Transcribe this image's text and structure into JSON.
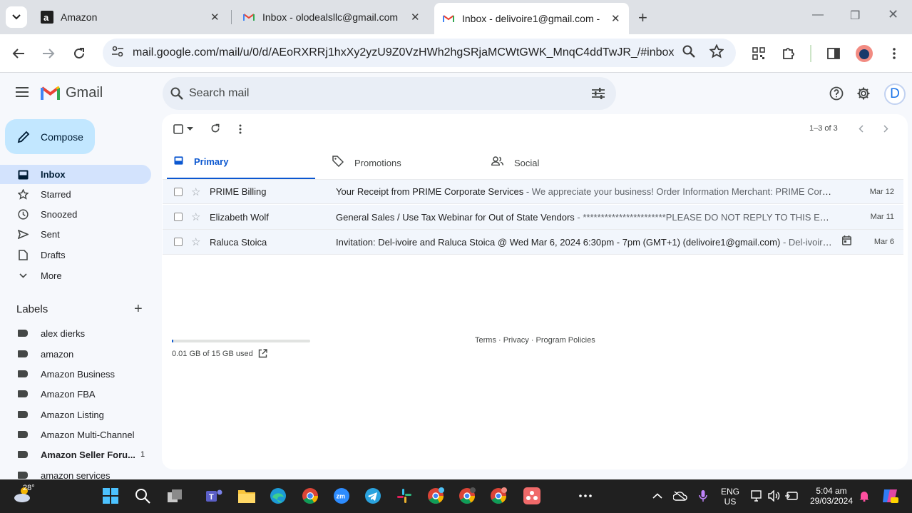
{
  "browser": {
    "tabs": [
      {
        "title": "Amazon",
        "favicon": "amazon-icon"
      },
      {
        "title": "Inbox - olodealsllc@gmail.com",
        "favicon": "gmail-icon"
      },
      {
        "title": "Inbox - delivoire1@gmail.com -",
        "favicon": "gmail-icon",
        "active": true
      }
    ],
    "url": "mail.google.com/mail/u/0/d/AEoRXRRj1hxXy2yzU9Z0VzHWh2hgSRjaMCWtGWK_MnqC4ddTwJR_/#inbox"
  },
  "gmail": {
    "app_name": "Gmail",
    "search_placeholder": "Search mail",
    "avatar_letter": "D",
    "compose_label": "Compose",
    "nav": [
      {
        "label": "Inbox",
        "icon": "inbox-icon",
        "active": true
      },
      {
        "label": "Starred",
        "icon": "star-icon"
      },
      {
        "label": "Snoozed",
        "icon": "clock-icon"
      },
      {
        "label": "Sent",
        "icon": "send-icon"
      },
      {
        "label": "Drafts",
        "icon": "draft-icon"
      },
      {
        "label": "More",
        "icon": "chevron-down-icon"
      }
    ],
    "labels_heading": "Labels",
    "labels": [
      {
        "name": "alex dierks",
        "count": ""
      },
      {
        "name": "amazon",
        "count": ""
      },
      {
        "name": "Amazon Business",
        "count": ""
      },
      {
        "name": "Amazon FBA",
        "count": ""
      },
      {
        "name": "Amazon Listing",
        "count": ""
      },
      {
        "name": "Amazon Multi-Channel",
        "count": ""
      },
      {
        "name": "Amazon Seller Foru...",
        "count": "1",
        "bold": true
      },
      {
        "name": "amazon services",
        "count": ""
      }
    ],
    "pager": "1–3 of 3",
    "categories": [
      {
        "label": "Primary",
        "icon": "inbox-icon",
        "active": true
      },
      {
        "label": "Promotions",
        "icon": "tag-icon"
      },
      {
        "label": "Social",
        "icon": "people-icon"
      }
    ],
    "emails": [
      {
        "sender": "PRIME Billing",
        "subject": "Your Receipt from PRIME Corporate Services",
        "preview": " - We appreciate your business! Order Information Merchant: PRIME Corporate...",
        "date": "Mar 12"
      },
      {
        "sender": "Elizabeth Wolf",
        "subject": "General Sales / Use Tax Webinar for Out of State Vendors",
        "preview": " - ***********************PLEASE DO NOT REPLY TO THIS EMAIL*...",
        "date": "Mar 11"
      },
      {
        "sender": "Raluca Stoica",
        "subject": "Invitation: Del-ivoire and Raluca Stoica @ Wed Mar 6, 2024 6:30pm - 7pm (GMT+1) (delivoire1@gmail.com)",
        "preview": " - Del-ivoire and ...",
        "date": "Mar 6",
        "calendar": true
      }
    ],
    "storage": "0.01 GB of 15 GB used",
    "storage_fraction": 0.001,
    "footer": "Terms · Privacy · Program Policies"
  },
  "taskbar": {
    "temperature": "28°",
    "language_1": "ENG",
    "language_2": "US",
    "time": "5:04 am",
    "date": "29/03/2024"
  }
}
